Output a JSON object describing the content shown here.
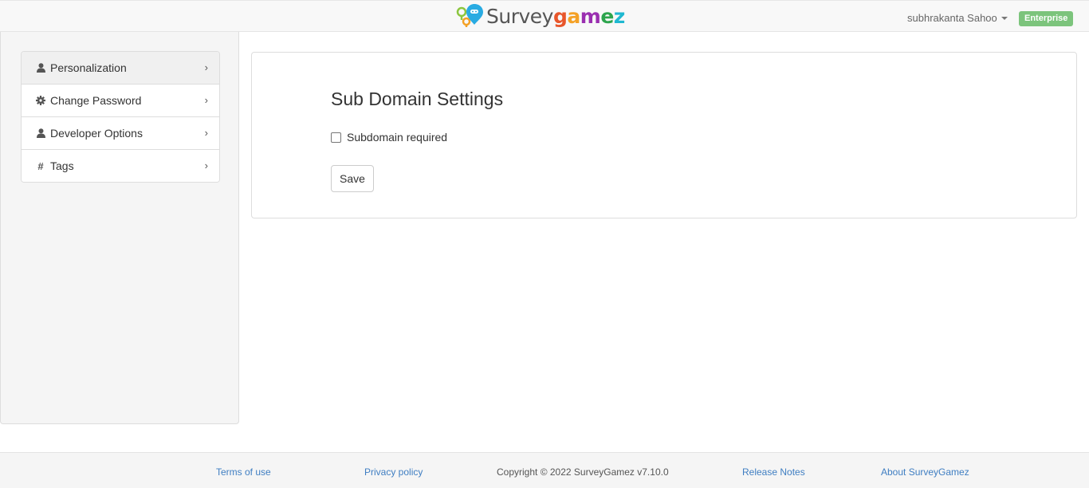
{
  "header": {
    "logo": {
      "text_survey": "Survey",
      "text_gamez": "gamez"
    },
    "user_name": "subhrakanta Sahoo",
    "plan_badge": "Enterprise",
    "colors": {
      "badge": "#7cc47c",
      "logo_g": "#e8562b",
      "logo_a": "#f4a126",
      "logo_m": "#9a2fb0",
      "logo_e": "#2da54d",
      "logo_z": "#1fb8d1"
    }
  },
  "sidebar": {
    "items": [
      {
        "label": "Personalization",
        "icon": "user-icon"
      },
      {
        "label": "Change Password",
        "icon": "gear-icon"
      },
      {
        "label": "Developer Options",
        "icon": "user-icon"
      },
      {
        "label": "Tags",
        "icon": "hash-icon"
      }
    ]
  },
  "main": {
    "title": "Sub Domain Settings",
    "checkbox_label": "Subdomain required",
    "checkbox_checked": false,
    "save_label": "Save"
  },
  "footer": {
    "terms": "Terms of use",
    "privacy": "Privacy policy",
    "copyright": "Copyright © 2022 SurveyGamez v7.10.0",
    "release_notes": "Release Notes",
    "about": "About SurveyGamez",
    "link_color": "#3f7ec2"
  }
}
